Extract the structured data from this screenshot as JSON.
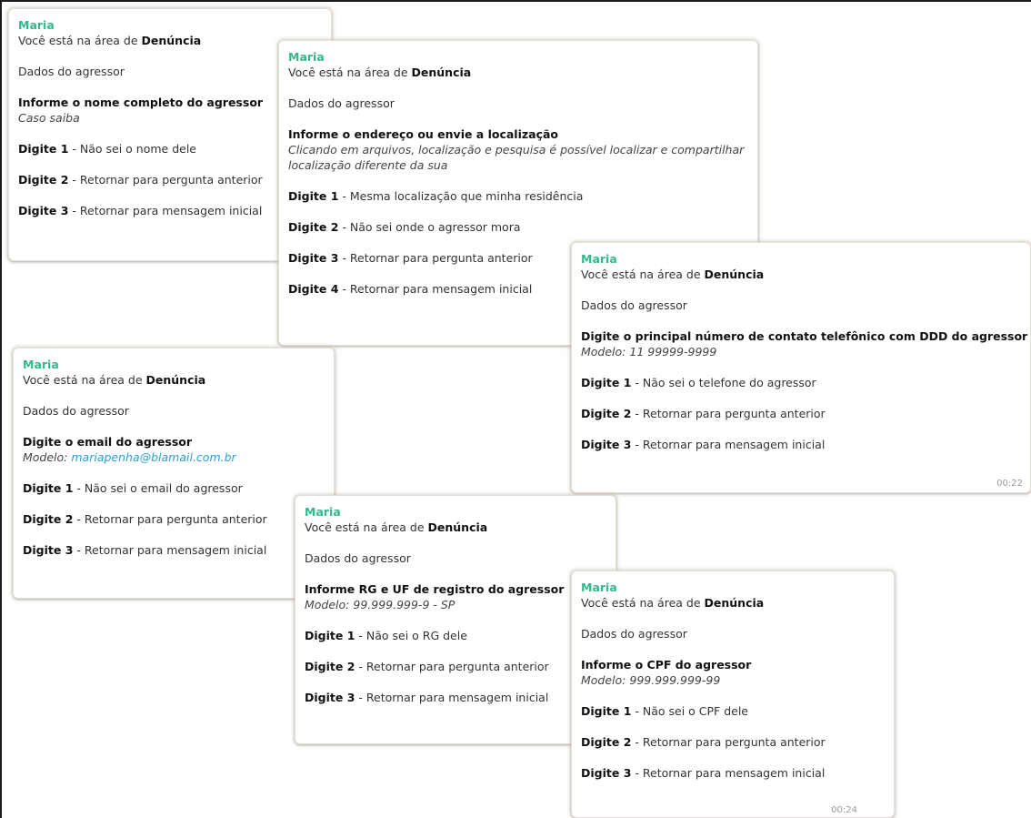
{
  "sender": "Maria",
  "area_prefix": "Você está na área de ",
  "area_name": "Denúncia",
  "section": "Dados do agressor",
  "digit_word": "Digite",
  "bubbles": [
    {
      "question": "Informe o nome completo do agressor",
      "hint": "Caso saiba",
      "options": [
        {
          "num": "1",
          "text": " - Não sei o nome dele"
        },
        {
          "num": "2",
          "text": " - Retornar para pergunta anterior"
        },
        {
          "num": "3",
          "text": " - Retornar para mensagem inicial"
        }
      ]
    },
    {
      "question": "Informe o endereço ou envie a localização",
      "hint": "Clicando em arquivos, localização e pesquisa é possível localizar e compartilhar localização diferente da sua",
      "options": [
        {
          "num": "1",
          "text": " - Mesma localização que minha residência"
        },
        {
          "num": "2",
          "text": " - Não sei onde o agressor mora"
        },
        {
          "num": "3",
          "text": " - Retornar para pergunta anterior"
        },
        {
          "num": "4",
          "text": " - Retornar para mensagem inicial"
        }
      ]
    },
    {
      "question": "Digite o principal número de contato telefônico com DDD do agressor",
      "hint": "Modelo: 11 99999-9999",
      "time": "00:22",
      "options": [
        {
          "num": "1",
          "text": " - Não sei o telefone do agressor"
        },
        {
          "num": "2",
          "text": " - Retornar para pergunta anterior"
        },
        {
          "num": "3",
          "text": " - Retornar para mensagem inicial"
        }
      ]
    },
    {
      "question": "Digite o email do agressor",
      "hint_prefix": "Modelo: ",
      "hint_email": "mariapenha@blamail.com.br",
      "options": [
        {
          "num": "1",
          "text": " - Não sei o email do agressor"
        },
        {
          "num": "2",
          "text": " - Retornar para pergunta anterior"
        },
        {
          "num": "3",
          "text": " - Retornar para mensagem inicial"
        }
      ]
    },
    {
      "question": "Informe RG e UF de registro do agressor",
      "hint": "Modelo: 99.999.999-9 - SP",
      "options": [
        {
          "num": "1",
          "text": " - Não sei o RG dele"
        },
        {
          "num": "2",
          "text": " - Retornar para pergunta anterior"
        },
        {
          "num": "3",
          "text": " - Retornar para mensagem inicial"
        }
      ]
    },
    {
      "question": "Informe o CPF do agressor",
      "hint": "Modelo: 999.999.999-99",
      "time": "00:24",
      "options": [
        {
          "num": "1",
          "text": " - Não sei o CPF dele"
        },
        {
          "num": "2",
          "text": " - Retornar para pergunta anterior"
        },
        {
          "num": "3",
          "text": " - Retornar para mensagem inicial"
        }
      ]
    }
  ],
  "colors": {
    "sender": "#35b889",
    "link": "#2a9fd0",
    "text": "#333333",
    "bubble_bg": "#ffffff"
  }
}
